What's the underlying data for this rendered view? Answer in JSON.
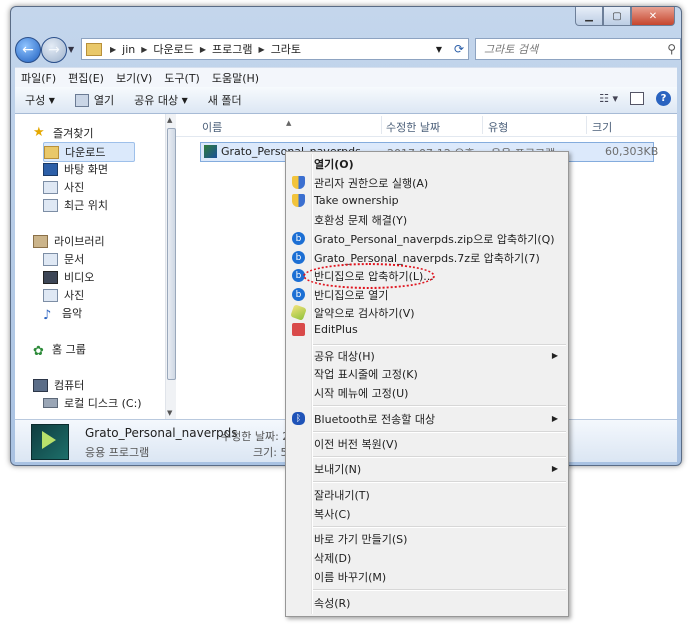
{
  "address": {
    "crumbs": [
      "jin",
      "다운로드",
      "프로그램",
      "그라토"
    ]
  },
  "search": {
    "placeholder": "그라토 검색"
  },
  "menubar": [
    "파일(F)",
    "편집(E)",
    "보기(V)",
    "도구(T)",
    "도움말(H)"
  ],
  "toolbar": {
    "organize": "구성",
    "open": "열기",
    "share": "공유 대상",
    "new_folder": "새 폴더"
  },
  "nav": {
    "favorites": "즐겨찾기",
    "fav_items": [
      "다운로드",
      "바탕 화면",
      "사진",
      "최근 위치"
    ],
    "libraries": "라이브러리",
    "lib_items": [
      "문서",
      "비디오",
      "사진",
      "음악"
    ],
    "homegroup": "홈 그룹",
    "computer": "컴퓨터",
    "local_disk": "로컬 디스크 (C:)"
  },
  "columns": {
    "name": "이름",
    "modified": "수정한 날짜",
    "type": "유형",
    "size": "크기"
  },
  "file": {
    "name": "Grato_Personal_naverpds",
    "modified": "2017-07-12 오후...",
    "type": "응용 프로그램",
    "size": "60,303KB"
  },
  "details": {
    "name": "Grato_Personal_naverpds",
    "type": "응용 프로그램",
    "modified_label": "수정한 날짜: 2",
    "size_label": "크기: 5"
  },
  "context_menu": {
    "open": "열기(O)",
    "run_as_admin": "관리자 권한으로 실행(A)",
    "take_ownership": "Take ownership",
    "compat": "호환성 문제 해결(Y)",
    "zip": "Grato_Personal_naverpds.zip으로 압축하기(Q)",
    "sevenz": "Grato_Personal_naverpds.7z로 압축하기(7)",
    "bandizip_compress": "반디집으로 압축하기(L)...",
    "bandizip_open": "반디집으로 열기",
    "alyac": "알약으로 검사하기(V)",
    "editplus": "EditPlus",
    "share": "공유 대상(H)",
    "pin_taskbar": "작업 표시줄에 고정(K)",
    "pin_start": "시작 메뉴에 고정(U)",
    "bluetooth": "Bluetooth로 전송할 대상",
    "restore": "이전 버전 복원(V)",
    "send_to": "보내기(N)",
    "cut": "잘라내기(T)",
    "copy": "복사(C)",
    "shortcut": "바로 가기 만들기(S)",
    "delete": "삭제(D)",
    "rename": "이름 바꾸기(M)",
    "properties": "속성(R)"
  }
}
